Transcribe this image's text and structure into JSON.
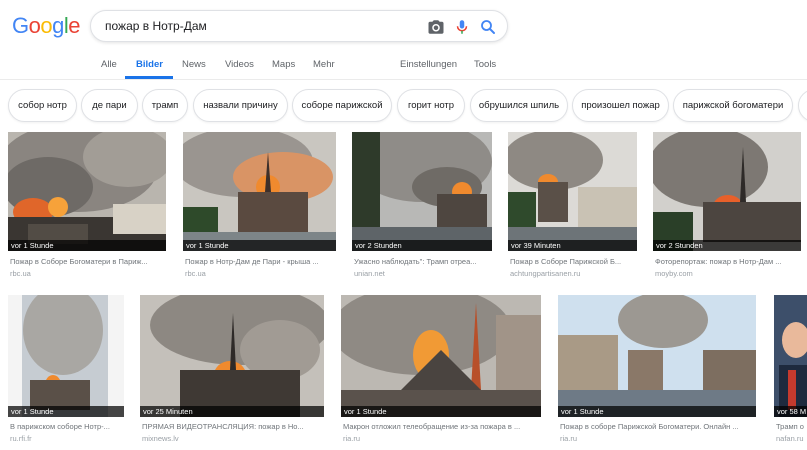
{
  "logo": [
    "G",
    "o",
    "o",
    "g",
    "l",
    "e"
  ],
  "colors": {
    "blue": "#4285F4",
    "red": "#EA4335",
    "yellow": "#FBBC05",
    "green": "#34A853",
    "accent": "#1a73e8"
  },
  "search": {
    "query": "пожар в Нотр-Дам"
  },
  "icons": {
    "camera": "camera-icon",
    "mic": "mic-icon",
    "search": "search-icon"
  },
  "tabs": {
    "alle": "Alle",
    "bilder": "Bilder",
    "news": "News",
    "videos": "Videos",
    "maps": "Maps",
    "mehr": "Mehr",
    "einstellungen": "Einstellungen",
    "tools": "Tools"
  },
  "chips": [
    "собор нотр",
    "де пари",
    "трамп",
    "назвали причину",
    "соборе парижской",
    "горит нотр",
    "обрушился шпиль",
    "произошел пожар",
    "парижской богоматери"
  ],
  "images": [
    {
      "badge": "vor 1 Stunde",
      "title": "Пожар в Соборе Богоматери в Париж...",
      "source": "rbc.ua"
    },
    {
      "badge": "vor 1 Stunde",
      "title": "Пожар в Нотр-Дам де Пари - крыша ...",
      "source": "rbc.ua"
    },
    {
      "badge": "vor 2 Stunden",
      "title": "Ужасно наблюдать\": Трамп отреа...",
      "source": "unian.net"
    },
    {
      "badge": "vor 39 Minuten",
      "title": "Пожар в Соборе Парижской Б...",
      "source": "achtungpartisanen.ru"
    },
    {
      "badge": "vor 2 Stunden",
      "title": "Фоторепортаж: пожар в Нотр-Дам ...",
      "source": "moyby.com"
    },
    {
      "badge": "vor 1 Stunde",
      "title": "В парижском соборе Нотр-...",
      "source": "ru.rfi.fr"
    },
    {
      "badge": "vor 25 Minuten",
      "title": "ПРЯМАЯ ВИДЕОТРАНСЛЯЦИЯ: пожар в Но...",
      "source": "mixnews.lv"
    },
    {
      "badge": "vor 1 Stunde",
      "title": "Макрон отложил телеобращение из-за пожара в ...",
      "source": "ria.ru"
    },
    {
      "badge": "vor 1 Stunde",
      "title": "Пожар в соборе Парижской Богоматери. Онлайн ...",
      "source": "ria.ru"
    },
    {
      "badge": "vor 58 M",
      "title": "Трамп о",
      "source": "nafan.ru"
    }
  ]
}
